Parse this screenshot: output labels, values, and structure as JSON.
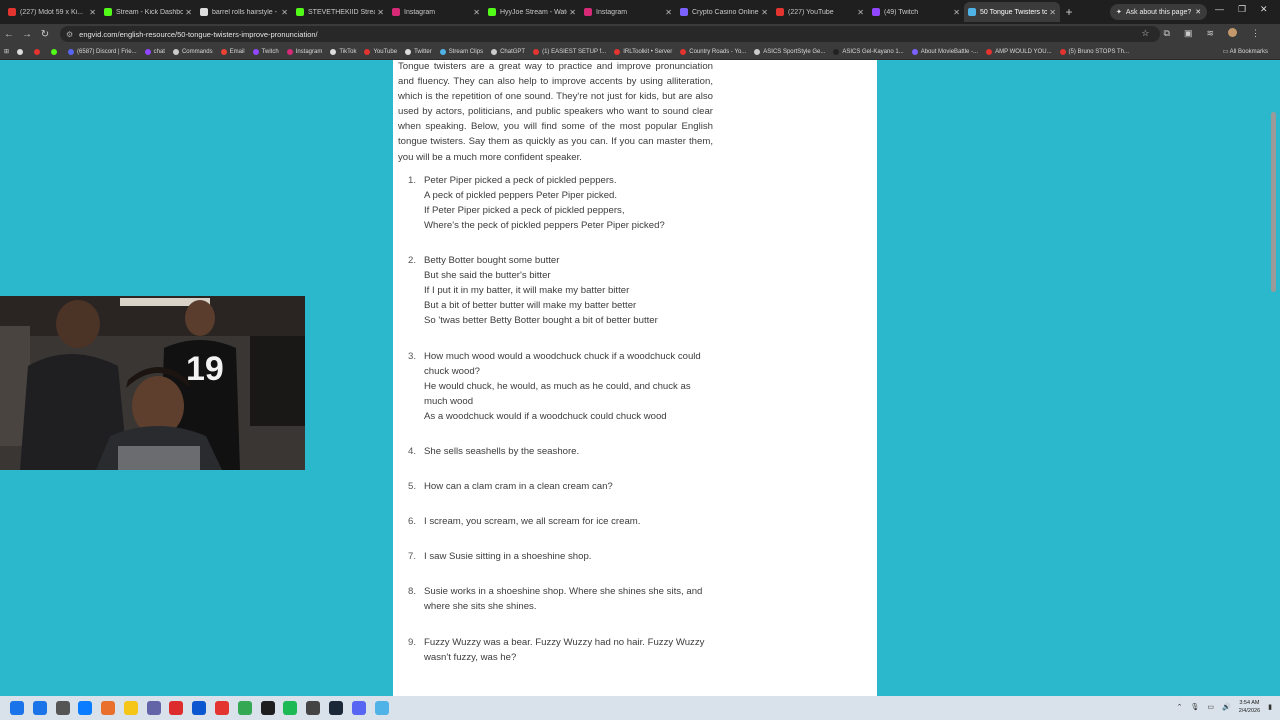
{
  "tabs": [
    {
      "title": "(227) Mdot 59 x Ki...",
      "color": "#e3342f"
    },
    {
      "title": "Stream - Kick Dashbo...",
      "color": "#53fc18"
    },
    {
      "title": "barrel rolls hairstyle - ...",
      "color": "#dddddd"
    },
    {
      "title": "STEVETHEKIID Stream...",
      "color": "#53fc18"
    },
    {
      "title": "Instagram",
      "color": "#d62976"
    },
    {
      "title": "HyyJoe Stream - Watch...",
      "color": "#53fc18"
    },
    {
      "title": "Instagram",
      "color": "#d62976"
    },
    {
      "title": "Crypto Casino Online",
      "color": "#7b61ff"
    },
    {
      "title": "(227) YouTube",
      "color": "#e3342f"
    },
    {
      "title": "(49) Twitch",
      "color": "#9146ff"
    },
    {
      "title": "50 Tongue Twisters to ...",
      "color": "#4fb3e8",
      "active": true
    }
  ],
  "ask_button": "Ask about this page?",
  "url": "engvid.com/english-resource/50-tongue-twisters-improve-pronunciation/",
  "bookmarks": [
    {
      "label": "",
      "color": "#dddddd"
    },
    {
      "label": "",
      "color": "#e3342f"
    },
    {
      "label": "",
      "color": "#53fc18"
    },
    {
      "label": "(6587) Discord | Frie...",
      "color": "#5865f2"
    },
    {
      "label": "chat",
      "color": "#9146ff"
    },
    {
      "label": "Commands",
      "color": "#cccccc"
    },
    {
      "label": "Email",
      "color": "#ea4335"
    },
    {
      "label": "Twitch",
      "color": "#9146ff"
    },
    {
      "label": "Instagram",
      "color": "#d62976"
    },
    {
      "label": "TikTok",
      "color": "#dddddd"
    },
    {
      "label": "YouTube",
      "color": "#e3342f"
    },
    {
      "label": "Twitter",
      "color": "#dddddd"
    },
    {
      "label": "Stream Clips",
      "color": "#4fb3e8"
    },
    {
      "label": "ChatGPT",
      "color": "#cccccc"
    },
    {
      "label": "(1) EASIEST SETUP f...",
      "color": "#e3342f"
    },
    {
      "label": "IRLToolkit • Server",
      "color": "#e3342f"
    },
    {
      "label": "Country Roads - Yo...",
      "color": "#e3342f"
    },
    {
      "label": "ASICS SportStyle Ge...",
      "color": "#cccccc"
    },
    {
      "label": "ASICS Gel-Kayano 1...",
      "color": "#222222"
    },
    {
      "label": "About MovieBattle -...",
      "color": "#7b61ff"
    },
    {
      "label": "AMP WOULD YOU...",
      "color": "#e3342f"
    },
    {
      "label": "(5) Bruno STOPS Th...",
      "color": "#e3342f"
    }
  ],
  "all_bookmarks": "All Bookmarks",
  "article": {
    "intro": "Tongue twisters are a great way to practice and improve pronunciation and fluency. They can also help to improve accents by using alliteration, which is the repetition of one sound. They're not just for kids, but are also used by actors, politicians, and public speakers who want to sound clear when speaking. Below, you will find some of the most popular English tongue twisters. Say them as quickly as you can. If you can master them, you will be a much more confident speaker.",
    "twisters": [
      {
        "num": "1.",
        "lines": [
          "Peter Piper picked a peck of pickled peppers.",
          "A peck of pickled peppers Peter Piper picked.",
          "If Peter Piper picked a peck of pickled peppers,",
          "Where's the peck of pickled peppers Peter Piper picked?"
        ]
      },
      {
        "num": "2.",
        "lines": [
          "Betty Botter bought some butter",
          "But she said the butter's bitter",
          "If I put it in my batter, it will make my batter bitter",
          "But a bit of better butter will make my batter better",
          "So 'twas better Betty Botter bought a bit of better butter"
        ]
      },
      {
        "num": "3.",
        "lines": [
          "How much wood would a woodchuck chuck if a woodchuck could chuck wood?",
          "He would chuck, he would, as much as he could, and chuck as much wood",
          "As a woodchuck would if a woodchuck could chuck wood"
        ]
      },
      {
        "num": "4.",
        "lines": [
          "She sells seashells by the seashore."
        ]
      },
      {
        "num": "5.",
        "lines": [
          "How can a clam cram in a clean cream can?"
        ]
      },
      {
        "num": "6.",
        "lines": [
          "I scream, you scream, we all scream for ice cream."
        ]
      },
      {
        "num": "7.",
        "lines": [
          "I saw Susie sitting in a shoeshine shop."
        ]
      },
      {
        "num": "8.",
        "lines": [
          "Susie works in a shoeshine shop. Where she shines she sits, and where she sits she shines."
        ]
      },
      {
        "num": "9.",
        "lines": [
          "Fuzzy Wuzzy was a bear. Fuzzy Wuzzy had no hair. Fuzzy Wuzzy wasn't fuzzy, was he?"
        ]
      }
    ]
  },
  "webcam": {
    "jersey_number": "19"
  },
  "clock": {
    "time": "3:54 AM",
    "date": "2/4/2026"
  },
  "taskbar_icons": [
    "#1a73e8",
    "#555555",
    "#0a7cff",
    "#e86f2c",
    "#f5c518",
    "#6264a7",
    "#dd2c2c",
    "#0b57d0",
    "#e3342f",
    "#34a853",
    "#1e1e1e",
    "#1db954",
    "#444444",
    "#1b2838",
    "#5865f2",
    "#4fb3e8"
  ]
}
